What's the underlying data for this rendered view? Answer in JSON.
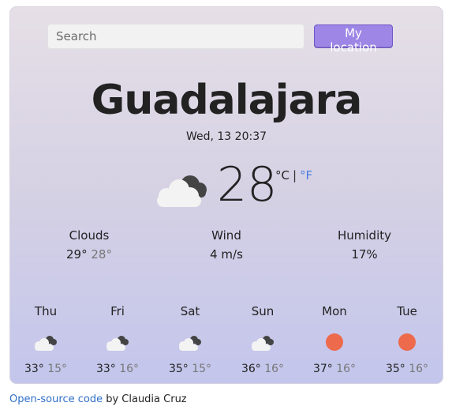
{
  "search": {
    "placeholder": "Search"
  },
  "location_button": {
    "label": "My location"
  },
  "city": "Guadalajara",
  "date": "Wed, 13 20:37",
  "current": {
    "icon": "clouds-icon",
    "temp": "28",
    "unit_c": "°C",
    "unit_sep": "|",
    "unit_f": "°F"
  },
  "stats": [
    {
      "label": "Clouds",
      "main": "29°",
      "sub": "28°"
    },
    {
      "label": "Wind",
      "main": "4 m/s",
      "sub": ""
    },
    {
      "label": "Humidity",
      "main": "17%",
      "sub": ""
    }
  ],
  "forecast": [
    {
      "day": "Thu",
      "icon": "clouds-icon",
      "high": "33°",
      "low": "15°"
    },
    {
      "day": "Fri",
      "icon": "clouds-icon",
      "high": "33°",
      "low": "16°"
    },
    {
      "day": "Sat",
      "icon": "clouds-icon",
      "high": "35°",
      "low": "15°"
    },
    {
      "day": "Sun",
      "icon": "clouds-icon",
      "high": "36°",
      "low": "16°"
    },
    {
      "day": "Mon",
      "icon": "sun-icon",
      "high": "37°",
      "low": "16°"
    },
    {
      "day": "Tue",
      "icon": "sun-icon",
      "high": "35°",
      "low": "16°"
    }
  ],
  "footer": {
    "link_text": "Open-source code",
    "suffix": " by Claudia Cruz"
  },
  "colors": {
    "accent": "#9d86e6",
    "sun": "#ee6a4c",
    "link": "#2f6fc8"
  }
}
